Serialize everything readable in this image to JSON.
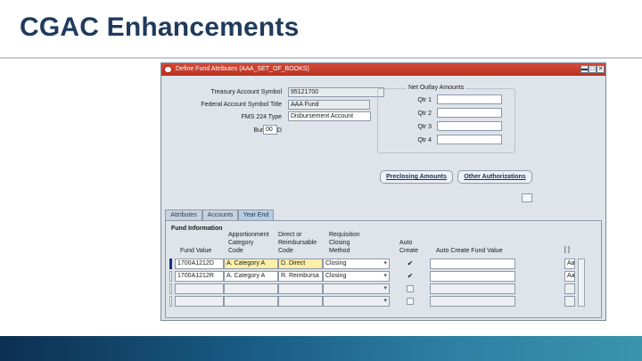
{
  "slide": {
    "title": "CGAC Enhancements"
  },
  "window": {
    "title": "Define Fund Attributes (AAA_SET_OF_BOOKS)",
    "minimize_glyph": "▬",
    "maximize_glyph": "□",
    "close_glyph": "✕"
  },
  "form": {
    "treasury_account_symbol": {
      "label": "Treasury Account Symbol",
      "value": "95121700"
    },
    "federal_account_symbol_title": {
      "label": "Federal Account Symbol Title",
      "value": "AAA Fund"
    },
    "fms_224_type": {
      "label": "FMS 224 Type",
      "value": "Disbursement Account"
    },
    "bureau_id": {
      "label": "Bureau ID",
      "value": "00"
    }
  },
  "net_outlay": {
    "title": "Net Outlay Amounts",
    "quarters": [
      {
        "label": "Qtr 1",
        "value": ""
      },
      {
        "label": "Qtr 2",
        "value": ""
      },
      {
        "label": "Qtr 3",
        "value": ""
      },
      {
        "label": "Qtr 4",
        "value": ""
      }
    ]
  },
  "buttons": {
    "preclosing": "Preclosing Amounts",
    "other_authorizations": "Other Authorizations"
  },
  "tabs": [
    {
      "label": "Attributes",
      "active": false
    },
    {
      "label": "Accounts",
      "active": false
    },
    {
      "label": "Year End",
      "active": true
    }
  ],
  "fund_info": {
    "title": "Fund Information",
    "columns": {
      "fund_value": "Fund Value",
      "apportionment": [
        "Apportionment",
        "Category",
        "Code"
      ],
      "direct_reimb": [
        "Direct or",
        "Reimbursable",
        "Code"
      ],
      "requisition": [
        "Requisition",
        "Closing",
        "Method"
      ],
      "auto_create": [
        "Auto",
        "Create"
      ],
      "auto_create_fund_value": "Auto Create Fund Value",
      "extra": "[ ]"
    },
    "rows": [
      {
        "fund_value": "1700A1212D",
        "apportionment": "A. Category A",
        "direct_reimb": "D. Direct",
        "requisition": "Closing",
        "auto_create": true,
        "auto_create_fund_value": "",
        "extra": "Aa",
        "selected": true
      },
      {
        "fund_value": "1700A1212R",
        "apportionment": "A. Category A",
        "direct_reimb": "R. Reimbursa",
        "requisition": "Closing",
        "auto_create": true,
        "auto_create_fund_value": "",
        "extra": "Aa",
        "selected": false
      },
      {
        "fund_value": "",
        "apportionment": "",
        "direct_reimb": "",
        "requisition": "",
        "auto_create": false,
        "auto_create_fund_value": "",
        "extra": "",
        "selected": false
      },
      {
        "fund_value": "",
        "apportionment": "",
        "direct_reimb": "",
        "requisition": "",
        "auto_create": false,
        "auto_create_fund_value": "",
        "extra": "",
        "selected": false
      }
    ]
  },
  "colors": {
    "title": "#1f3b5c",
    "window_bg": "#dfe4ea",
    "titlebar": "#b8321f",
    "highlight": "#fcefa8"
  }
}
